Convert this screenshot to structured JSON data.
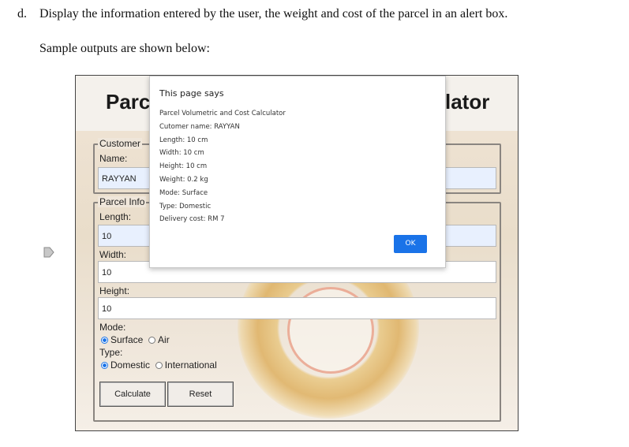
{
  "instruction": {
    "marker": "d.",
    "text": "Display the information entered by the user, the weight and cost of the parcel in an alert box."
  },
  "sample_caption": "Sample outputs are shown below:",
  "app": {
    "title_left": "Parc",
    "title_right": "lator",
    "customer_legend": "Customer",
    "name_label": "Name:",
    "name_value": "RAYYAN",
    "parcel_legend": "Parcel Info",
    "length_label": "Length:",
    "length_value": "10",
    "width_label": "Width:",
    "width_value": "10",
    "height_label": "Height:",
    "height_value": "10",
    "mode_label": "Mode:",
    "mode_options": [
      "Surface",
      "Air"
    ],
    "mode_selected": "Surface",
    "type_label": "Type:",
    "type_options": [
      "Domestic",
      "International"
    ],
    "type_selected": "Domestic",
    "calculate_label": "Calculate",
    "reset_label": "Reset"
  },
  "alert": {
    "title": "This page says",
    "lines": [
      "Parcel Volumetric and Cost Calculator",
      "Cutomer name: RAYYAN",
      "Length: 10 cm",
      "Width: 10 cm",
      "Height: 10 cm",
      "Weight: 0.2 kg",
      "Mode: Surface",
      "Type: Domestic",
      "Delivery cost: RM 7"
    ],
    "ok_label": "OK",
    "ok_color": "#1a73e8"
  },
  "icons": {
    "side_marker": "pointer-arrow-icon"
  }
}
